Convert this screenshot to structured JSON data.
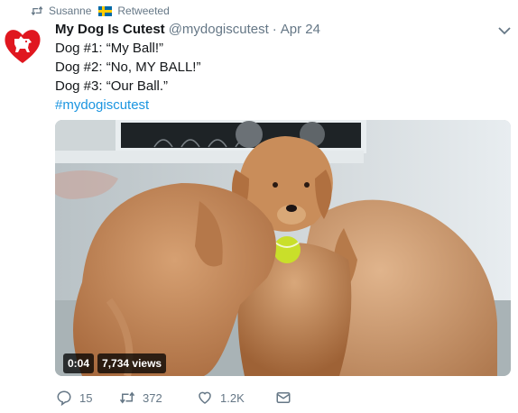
{
  "retweet_context": {
    "user": "Susanne",
    "flag": "sweden-flag",
    "label": "Retweeted"
  },
  "tweet": {
    "display_name": "My Dog Is Cutest",
    "handle": "@mydogiscutest",
    "separator": "·",
    "date": "Apr 24",
    "lines": [
      "Dog #1: “My Ball!”",
      "Dog #2: “No, MY BALL!”",
      "Dog #3: “Our Ball.”"
    ],
    "hashtag": "#mydogiscutest"
  },
  "media": {
    "type": "video",
    "duration": "0:04",
    "views": "7,734 views"
  },
  "actions": {
    "replies": "15",
    "retweets": "372",
    "likes": "1.2K"
  },
  "colors": {
    "text": "#14171a",
    "muted": "#657786",
    "link": "#1b95e0",
    "avatar_red": "#e0171f"
  },
  "icons": {
    "retweet_context": "retweet-icon",
    "menu": "chevron-down-icon",
    "reply": "reply-icon",
    "retweet": "retweet-icon",
    "like": "heart-icon",
    "dm": "envelope-icon"
  }
}
